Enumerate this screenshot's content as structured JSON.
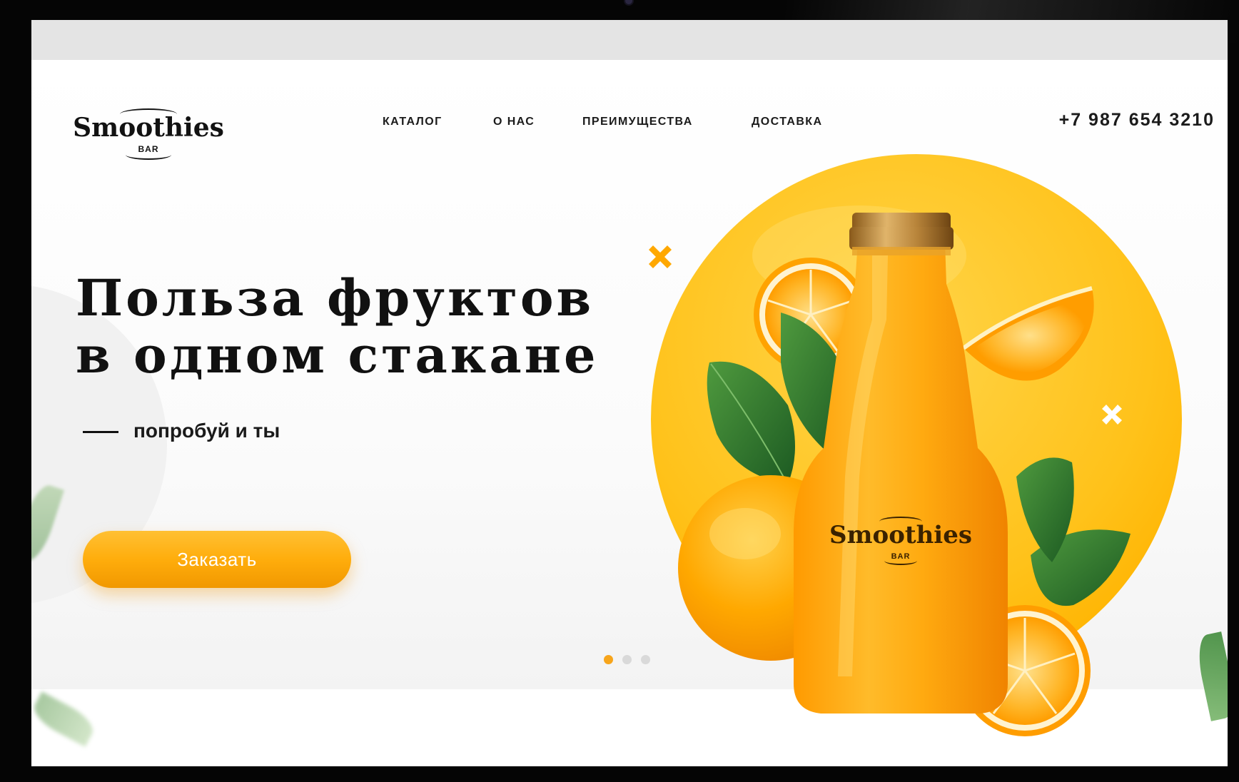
{
  "brand": {
    "name": "Smoothies",
    "sub": "BAR"
  },
  "nav": {
    "items": [
      {
        "label": "КАТАЛОГ"
      },
      {
        "label": "О НАС"
      },
      {
        "label": "ПРЕИМУЩЕСТВА"
      },
      {
        "label": "ДОСТАВКА"
      }
    ]
  },
  "header": {
    "phone": "+7 987 654 3210"
  },
  "hero": {
    "headline_line1": "Польза фруктов",
    "headline_line2": "в одном стакане",
    "tagline": "попробуй и ты",
    "cta_label": "Заказать",
    "bottle_label_name": "Smoothies",
    "bottle_label_sub": "BAR"
  },
  "slider": {
    "total": 3,
    "active_index": 0
  },
  "colors": {
    "accent": "#ffad0c",
    "accent_dark": "#f19800",
    "circle": "#ffc21f",
    "dot_active": "#f7a51b",
    "dot_inactive": "#d9d9d9",
    "text": "#111111"
  },
  "icons": {
    "cross_orange": "cross-icon",
    "cross_white": "cross-icon"
  }
}
